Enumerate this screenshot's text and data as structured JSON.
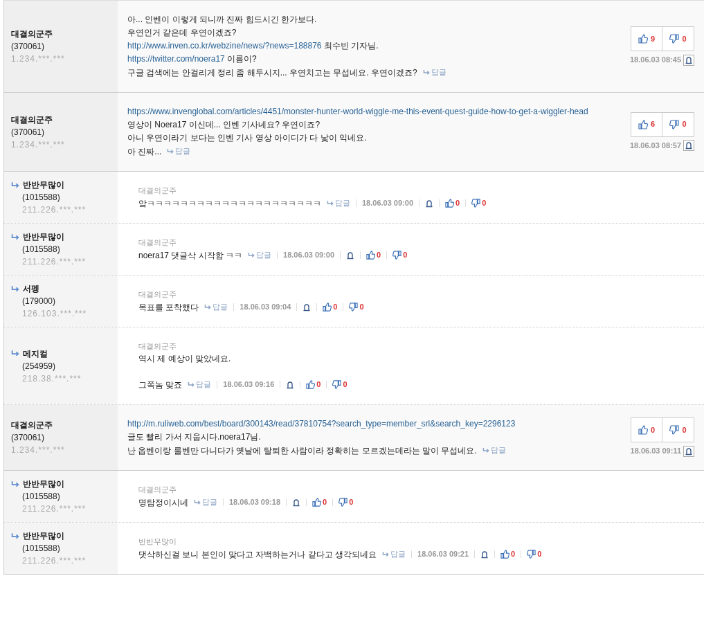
{
  "comments": [
    {
      "kind": "top",
      "author": "대결의군주",
      "user_id": "(370061)",
      "ip": "1.234.***.***",
      "lines": [
        [
          {
            "text": "아... 인벤이 이렇게 되니까 진짜 힘드시긴 한가보다.",
            "link": false
          }
        ],
        [
          {
            "text": "우연인거 같은데 우연이겠죠?",
            "link": false
          }
        ],
        [
          {
            "text": "http://www.inven.co.kr/webzine/news/?news=188876",
            "link": true
          },
          {
            "text": " 최수빈 기자님.",
            "link": false
          }
        ],
        [
          {
            "text": "https://twitter.com/noera17",
            "link": true
          },
          {
            "text": " 이름이?",
            "link": false
          }
        ],
        [
          {
            "text": "구글 검색에는 안걸리게 정리 좀 해두시지... 우연치고는 무섭네요. 우연이겠죠?",
            "link": false
          }
        ]
      ],
      "reply": "답글",
      "date": "18.06.03 08:45",
      "likes": "9",
      "dislikes": "0"
    },
    {
      "kind": "top",
      "author": "대결의군주",
      "user_id": "(370061)",
      "ip": "1.234.***.***",
      "lines": [
        [
          {
            "text": "https://www.invenglobal.com/articles/4451/monster-hunter-world-wiggle-me-this-event-quest-guide-how-to-get-a-wiggler-head",
            "link": true
          }
        ],
        [
          {
            "text": "영상이 Noera17 이신데... 인벤 기사네요? 우연이죠?",
            "link": false
          }
        ],
        [
          {
            "text": "아니 우연이라기 보다는 인벤 기사 영상 아이디가 다 낯이 익네요.",
            "link": false
          }
        ],
        [
          {
            "text": "아 진짜...",
            "link": false
          }
        ]
      ],
      "reply": "답글",
      "date": "18.06.03 08:57",
      "likes": "6",
      "dislikes": "0"
    },
    {
      "kind": "reply",
      "author": "반반무많이",
      "user_id": "(1015588)",
      "ip": "211.226.***.***",
      "parent": "대결의군주",
      "lines": [
        [
          {
            "text": "앜ㅋㅋㅋㅋㅋㅋㅋㅋㅋㅋㅋㅋㅋㅋㅋㅋㅋㅋㅋㅋㅋ",
            "link": false
          }
        ]
      ],
      "reply": "답글",
      "date": "18.06.03 09:00",
      "likes": "0",
      "dislikes": "0"
    },
    {
      "kind": "reply",
      "author": "반반무많이",
      "user_id": "(1015588)",
      "ip": "211.226.***.***",
      "parent": "대결의군주",
      "lines": [
        [
          {
            "text": "noera17 댓글삭 시작함 ㅋㅋ",
            "link": false
          }
        ]
      ],
      "reply": "답글",
      "date": "18.06.03 09:00",
      "likes": "0",
      "dislikes": "0"
    },
    {
      "kind": "reply",
      "author": "서펭",
      "user_id": "(179000)",
      "ip": "126.103.***.***",
      "parent": "대결의군주",
      "lines": [
        [
          {
            "text": "목표를 포착했다",
            "link": false
          }
        ]
      ],
      "reply": "답글",
      "date": "18.06.03 09:04",
      "likes": "0",
      "dislikes": "0"
    },
    {
      "kind": "reply",
      "author": "메지컬",
      "user_id": "(254959)",
      "ip": "218.38.***.***",
      "parent": "대결의군주",
      "lines": [
        [
          {
            "text": "역시 제 예상이 맞았네요.",
            "link": false
          }
        ]
      ],
      "after_gap": [
        [
          {
            "text": "그쪽놈 맞죠",
            "link": false
          }
        ]
      ],
      "reply": "답글",
      "date": "18.06.03 09:16",
      "likes": "0",
      "dislikes": "0"
    },
    {
      "kind": "top",
      "author": "대결의군주",
      "user_id": "(370061)",
      "ip": "1.234.***.***",
      "lines": [
        [
          {
            "text": "http://m.ruliweb.com/best/board/300143/read/37810754?search_type=member_srl&search_key=2296123",
            "link": true
          }
        ],
        [
          {
            "text": "글도 빨리 가서 지웁시다.noera17님.",
            "link": false
          }
        ],
        [
          {
            "text": "난 옵벤이랑 룰벤만 다니다가 옛날에 탈퇴한 사람이라 정확히는 모르겠는데라는 말이 무섭네요.",
            "link": false
          }
        ]
      ],
      "reply": "답글",
      "date": "18.06.03 09:11",
      "likes": "0",
      "dislikes": "0"
    },
    {
      "kind": "reply",
      "author": "반반무많이",
      "user_id": "(1015588)",
      "ip": "211.226.***.***",
      "parent": "대결의군주",
      "lines": [
        [
          {
            "text": "명탐정이시네",
            "link": false
          }
        ]
      ],
      "reply": "답글",
      "date": "18.06.03 09:18",
      "likes": "0",
      "dislikes": "0"
    },
    {
      "kind": "reply",
      "author": "반반무많이",
      "user_id": "(1015588)",
      "ip": "211.226.***.***",
      "parent": "반반무많이",
      "lines": [
        [
          {
            "text": "댓삭하신걸 보니 본인이 맞다고 자백하는거나 같다고 생각되네요",
            "link": false
          }
        ]
      ],
      "reply": "답글",
      "date": "18.06.03 09:21",
      "likes": "0",
      "dislikes": "0"
    }
  ]
}
